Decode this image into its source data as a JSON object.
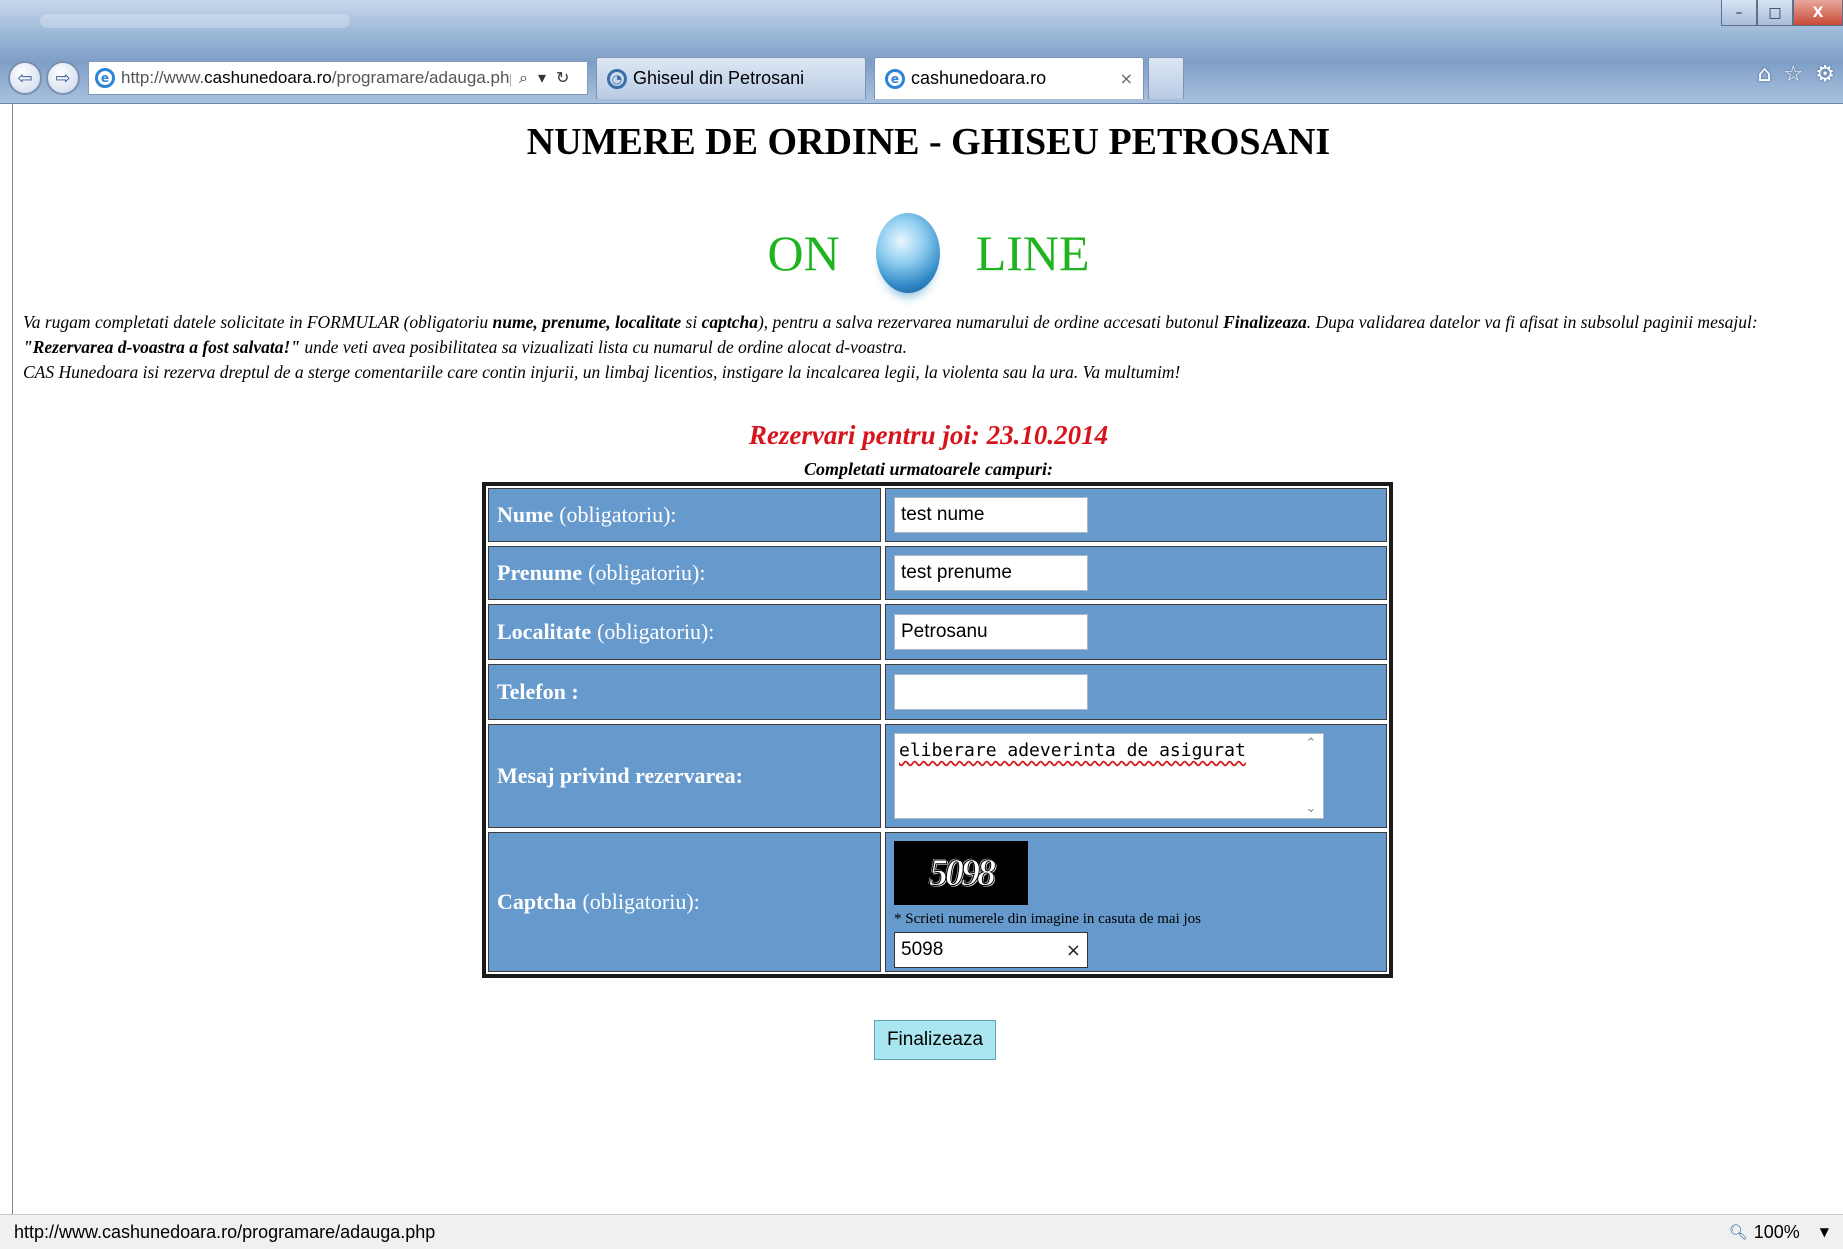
{
  "browser": {
    "address": {
      "prefix": "http://www.",
      "domain": "cashunedoara.ro",
      "path": "/programare/adauga.php"
    },
    "tabs": [
      {
        "label": "Ghiseul din Petrosani"
      },
      {
        "label": "cashunedoara.ro",
        "close": "×"
      }
    ],
    "window_controls": {
      "minimize": "–",
      "restore": "□",
      "close": "X"
    },
    "icons": {
      "back": "⇦",
      "forward": "⇨",
      "search": "⌕",
      "dropdown": "▾",
      "refresh": "↻",
      "home": "⌂",
      "favorites": "☆",
      "tools": "⚙"
    }
  },
  "page": {
    "title": "NUMERE DE ORDINE - GHISEU PETROSANI",
    "banner": {
      "left": "ON",
      "right": "LINE"
    },
    "intro": {
      "p1_a": "Va rugam completati datele solicitate in FORMULAR (obligatoriu ",
      "p1_b": "nume, prenume, localitate",
      "p1_c": " si ",
      "p1_d": "captcha",
      "p1_e": "), pentru a salva rezervarea numarului de ordine accesati butonul ",
      "p1_f": "Finalizeaza",
      "p1_g": ". Dupa validarea datelor va fi afisat in subsolul paginii mesajul: ",
      "p1_h": "\"Rezervarea d-voastra a fost salvata!\"",
      "p1_i": " unde veti avea posibilitatea sa vizualizati lista cu numarul de ordine alocat d-voastra.",
      "p2": "CAS Hunedoara isi rezerva dreptul de a sterge comentariile care contin injurii, un limbaj licentios, instigare la incalcarea legii, la violenta sau la ura. Va multumim!"
    },
    "reservation_title": "Rezervari pentru joi: 23.10.2014",
    "reservation_subtitle": "Completati urmatoarele campuri:",
    "form": {
      "nume": {
        "label": "Nume",
        "note": "(obligatoriu):",
        "value": "test nume"
      },
      "prenume": {
        "label": "Prenume",
        "note": "(obligatoriu):",
        "value": "test prenume"
      },
      "localitate": {
        "label": "Localitate",
        "note": "(obligatoriu):",
        "value": "Petrosanu"
      },
      "telefon": {
        "label": "Telefon :",
        "value": ""
      },
      "mesaj": {
        "label": "Mesaj privind rezervarea:",
        "value": "eliberare adeverinta de asigurat"
      },
      "captcha": {
        "label": "Captcha",
        "note": "(obligatoriu):",
        "image_text": "5098",
        "hint": "* Scrieti numerele din imagine in casuta de mai jos",
        "value": "5098",
        "clear": "×"
      }
    },
    "submit_label": "Finalizeaza"
  },
  "statusbar": {
    "url": "http://www.cashunedoara.ro/programare/adauga.php",
    "zoom": "100%",
    "zoom_dropdown": "▼"
  },
  "colors": {
    "form_cell": "#6699cc",
    "online_green": "#1fb41f",
    "reservation_red": "#d7141b",
    "button_bg": "#a9e6f0"
  }
}
